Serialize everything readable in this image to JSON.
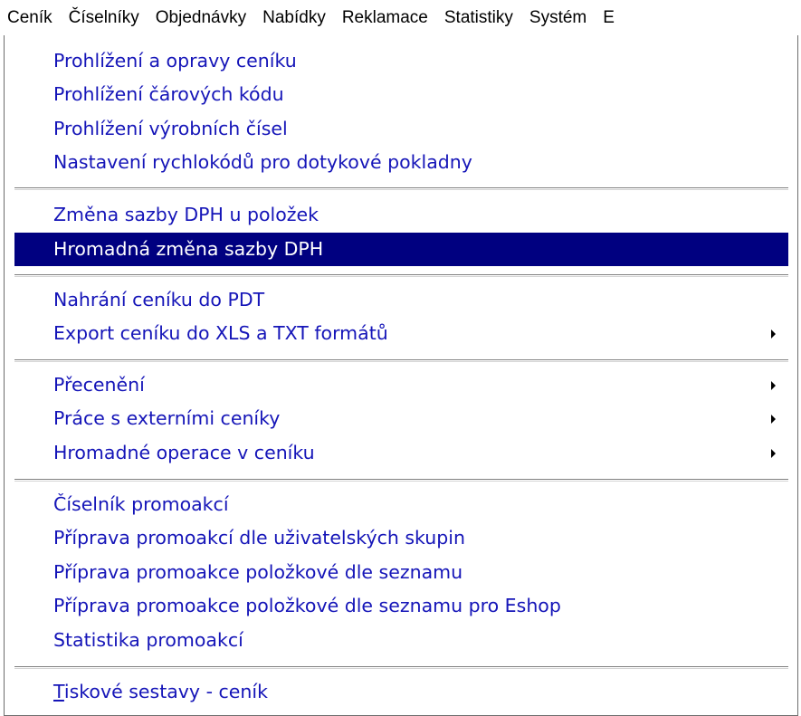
{
  "menubar": {
    "items": [
      "Ceník",
      "Číselníky",
      "Objednávky",
      "Nabídky",
      "Reklamace",
      "Statistiky",
      "Systém",
      "E"
    ]
  },
  "menu": {
    "group1": [
      "Prohlížení a opravy ceníku",
      "Prohlížení čárových kódu",
      "Prohlížení výrobních čísel",
      "Nastavení rychlokódů pro dotykové pokladny"
    ],
    "group2": [
      "Změna sazby DPH u položek",
      "Hromadná změna sazby DPH"
    ],
    "group3": [
      "Nahrání ceníku do PDT",
      "Export ceníku do XLS a TXT formátů"
    ],
    "group4": [
      "Přecenění",
      "Práce s externími ceníky",
      "Hromadné operace v ceníku"
    ],
    "group5": [
      "Číselník promoakcí",
      "Příprava promoakcí dle uživatelských skupin",
      "Příprava promoakce položkové dle seznamu",
      "Příprava promoakce položkové dle seznamu pro Eshop",
      "Statistika promoakcí"
    ],
    "group6": {
      "first_letter": "T",
      "rest": "iskové sestavy - ceník"
    },
    "selected_item": "Hromadná změna sazby DPH"
  },
  "colors": {
    "item_text": "#1515b8",
    "selected_bg": "#000080",
    "selected_text": "#ffffff"
  },
  "icons": {
    "submenu": "submenu-arrow-icon"
  }
}
